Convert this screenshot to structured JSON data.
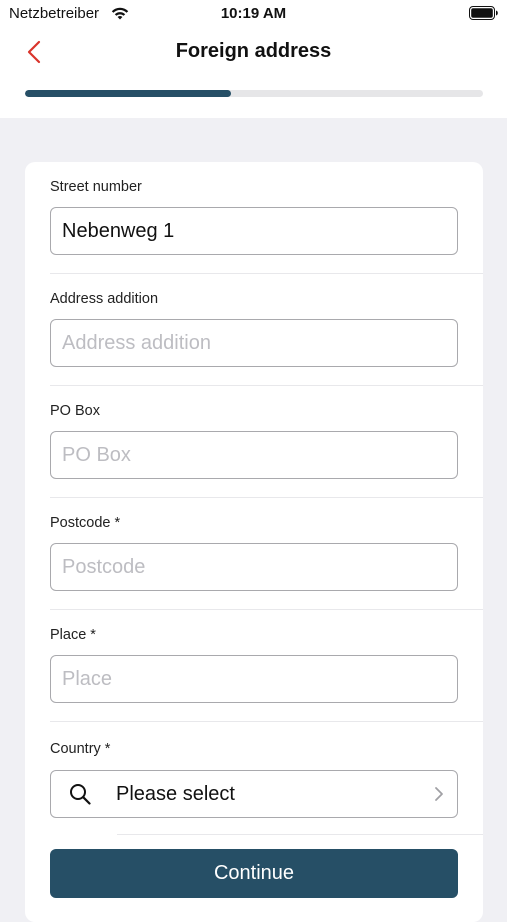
{
  "status_bar": {
    "carrier": "Netzbetreiber",
    "time": "10:19 AM"
  },
  "header": {
    "title": "Foreign address",
    "back_icon": "chevron-left-icon"
  },
  "progress": {
    "fraction": 0.45,
    "color": "#264f66",
    "track_color": "#e6e6e8"
  },
  "form": {
    "street_number": {
      "label": "Street number",
      "value": "Nebenweg 1",
      "placeholder": ""
    },
    "address_addition": {
      "label": "Address addition",
      "value": "",
      "placeholder": "Address addition"
    },
    "po_box": {
      "label": "PO Box",
      "value": "",
      "placeholder": "PO Box"
    },
    "postcode": {
      "label": "Postcode *",
      "value": "",
      "placeholder": "Postcode"
    },
    "place": {
      "label": "Place *",
      "value": "",
      "placeholder": "Place"
    },
    "country": {
      "label": "Country *",
      "selected": "Please select",
      "icon": "search-icon",
      "chevron_icon": "chevron-right-icon"
    }
  },
  "actions": {
    "continue_label": "Continue",
    "button_color": "#264f66"
  },
  "colors": {
    "accent_red": "#d9342b",
    "background": "#f0f0f4"
  }
}
